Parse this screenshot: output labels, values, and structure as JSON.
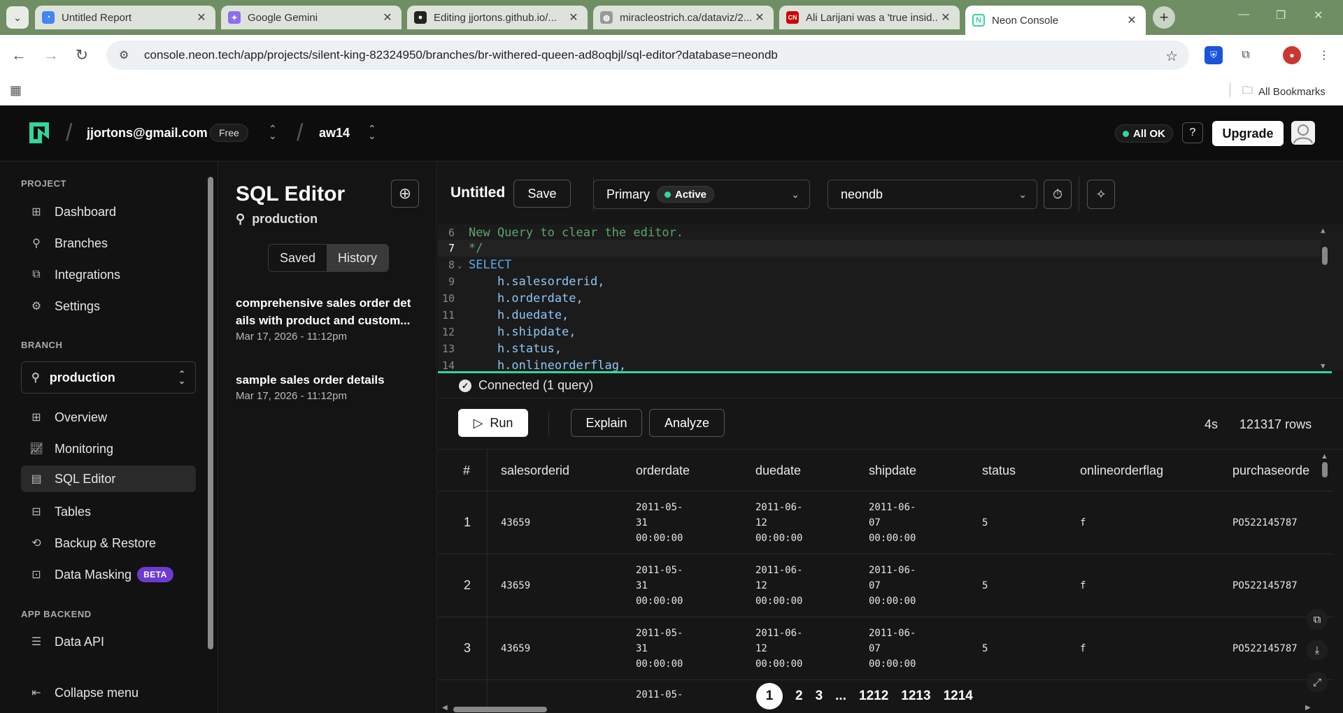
{
  "browser": {
    "tabs": [
      {
        "title": "Untitled Report",
        "favicon": "looker-icon",
        "color": "#4285f4"
      },
      {
        "title": "Google Gemini",
        "favicon": "gemini-icon",
        "color": "#8e6cf0"
      },
      {
        "title": "Editing jjortons.github.io/...",
        "favicon": "github-icon",
        "color": "#222222"
      },
      {
        "title": "miracleostrich.ca/dataviz/2...",
        "favicon": "globe-icon",
        "color": "#888888"
      },
      {
        "title": "Ali Larijani was a 'true insid...",
        "favicon": "cnn-icon",
        "color": "#cc0000"
      },
      {
        "title": "Neon Console",
        "favicon": "neon-icon",
        "color": "#34d59a"
      }
    ],
    "url": "console.neon.tech/app/projects/silent-king-82324950/branches/br-withered-queen-ad8oqbjl/sql-editor?database=neondb",
    "bookmarks_label": "All Bookmarks"
  },
  "header": {
    "email": "jjortons@gmail.com",
    "plan": "Free",
    "project": "aw14",
    "status": "All OK",
    "help": "?",
    "upgrade": "Upgrade"
  },
  "sidebar": {
    "project_section": "PROJECT",
    "project_items": [
      {
        "label": "Dashboard",
        "icon": "grid-icon"
      },
      {
        "label": "Branches",
        "icon": "branch-icon"
      },
      {
        "label": "Integrations",
        "icon": "puzzle-icon"
      },
      {
        "label": "Settings",
        "icon": "gear-icon"
      }
    ],
    "branch_section": "BRANCH",
    "branch_select": "production",
    "branch_items": [
      {
        "label": "Overview",
        "icon": "grid-icon"
      },
      {
        "label": "Monitoring",
        "icon": "chart-icon"
      },
      {
        "label": "SQL Editor",
        "icon": "terminal-icon"
      },
      {
        "label": "Tables",
        "icon": "table-icon"
      },
      {
        "label": "Backup & Restore",
        "icon": "history-icon"
      },
      {
        "label": "Data Masking",
        "icon": "mask-icon"
      }
    ],
    "beta": "BETA",
    "app_backend_section": "APP BACKEND",
    "backend_items": [
      {
        "label": "Data API",
        "icon": "api-icon"
      }
    ],
    "collapse": "Collapse menu"
  },
  "history_panel": {
    "title": "SQL Editor",
    "branch": "production",
    "tabs": [
      "Saved",
      "History"
    ],
    "items": [
      {
        "title": "comprehensive sales order det ails with product and custom...",
        "date": "Mar 17, 2026 - 11:12pm"
      },
      {
        "title": "sample sales order details",
        "date": "Mar 17, 2026 - 11:12pm"
      }
    ]
  },
  "editor": {
    "query_title": "Untitled",
    "save": "Save",
    "compute": "Primary",
    "compute_status": "Active",
    "database": "neondb",
    "lines": [
      {
        "n": "6",
        "text": "New Query to clear the editor.",
        "kind": "comment"
      },
      {
        "n": "7",
        "text": "*/",
        "kind": "comment"
      },
      {
        "n": "8",
        "text": "SELECT",
        "kind": "kw"
      },
      {
        "n": "9",
        "text": "    h.salesorderid,",
        "kind": "ident"
      },
      {
        "n": "10",
        "text": "    h.orderdate,",
        "kind": "ident"
      },
      {
        "n": "11",
        "text": "    h.duedate,",
        "kind": "ident"
      },
      {
        "n": "12",
        "text": "    h.shipdate,",
        "kind": "ident"
      },
      {
        "n": "13",
        "text": "    h.status,",
        "kind": "ident"
      },
      {
        "n": "14",
        "text": "    h.onlineorderflag,",
        "kind": "ident"
      }
    ],
    "connection": "Connected (1 query)",
    "run": "Run",
    "explain": "Explain",
    "analyze": "Analyze",
    "duration": "4s",
    "rows": "121317 rows"
  },
  "results": {
    "columns": [
      "#",
      "salesorderid",
      "orderdate",
      "duedate",
      "shipdate",
      "status",
      "onlineorderflag",
      "purchaseorde"
    ],
    "rows": [
      {
        "n": "1",
        "salesorderid": "43659",
        "orderdate": "2011-05-\n31\n00:00:00",
        "duedate": "2011-06-\n12\n00:00:00",
        "shipdate": "2011-06-\n07\n00:00:00",
        "status": "5",
        "online": "f",
        "po": "PO522145787"
      },
      {
        "n": "2",
        "salesorderid": "43659",
        "orderdate": "2011-05-\n31\n00:00:00",
        "duedate": "2011-06-\n12\n00:00:00",
        "shipdate": "2011-06-\n07\n00:00:00",
        "status": "5",
        "online": "f",
        "po": "PO522145787"
      },
      {
        "n": "3",
        "salesorderid": "43659",
        "orderdate": "2011-05-\n31\n00:00:00",
        "duedate": "2011-06-\n12\n00:00:00",
        "shipdate": "2011-06-\n07\n00:00:00",
        "status": "5",
        "online": "f",
        "po": "PO522145787"
      },
      {
        "n": "",
        "salesorderid": "",
        "orderdate": "2011-05-",
        "duedate": "",
        "shipdate": "",
        "status": "",
        "online": "",
        "po": ""
      }
    ],
    "pages": [
      "1",
      "2",
      "3",
      "...",
      "1212",
      "1213",
      "1214"
    ]
  },
  "colors": {
    "accent": "#34d59a",
    "beta": "#6d3bd1"
  }
}
